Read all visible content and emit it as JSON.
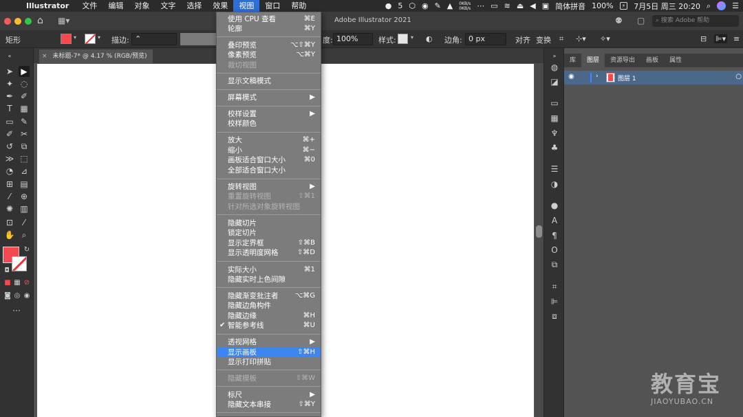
{
  "menubar": {
    "app_name": "Illustrator",
    "items": [
      "文件",
      "编辑",
      "对象",
      "文字",
      "选择",
      "效果",
      "视图",
      "窗口",
      "帮助"
    ],
    "active_index": 6,
    "status": {
      "wechat_count": "5",
      "net_up": "0KB/s",
      "net_down": "0KB/s",
      "input_method": "简体拼音",
      "battery": "100%",
      "battery_icon_text": "⚡",
      "datetime": "7月5日 周三 20:20"
    }
  },
  "titlebar": {
    "title": "Adobe Illustrator 2021",
    "search_placeholder": "搜索 Adobe 帮助"
  },
  "controlbar": {
    "shape_label": "矩形",
    "stroke_label": "描边:",
    "opacity_partial": "度:",
    "opacity_value": "100%",
    "style_label": "样式:",
    "corner_label": "边角:",
    "corner_value": "0 px",
    "align_label": "对齐",
    "transform_label": "变换"
  },
  "document_tab": {
    "title": "未标题-7* @ 4.17 % (RGB/预览)"
  },
  "layers_panel": {
    "tabs": [
      "库",
      "图层",
      "资源导出",
      "画板",
      "属性"
    ],
    "active_tab": 1,
    "layer_name": "图层 1"
  },
  "view_menu": {
    "items": [
      {
        "label": "使用 CPU 查看",
        "shortcut": "⌘E"
      },
      {
        "label": "轮廓",
        "shortcut": "⌘Y"
      },
      {
        "label": "叠印预览",
        "shortcut": "⌥⇧⌘Y"
      },
      {
        "label": "像素预览",
        "shortcut": "⌥⌘Y"
      },
      {
        "label": "裁切视图",
        "shortcut": ""
      },
      {
        "label": "显示文稿模式",
        "shortcut": ""
      },
      {
        "label": "屏幕模式",
        "shortcut": "▶"
      },
      {
        "label": "校样设置",
        "shortcut": "▶"
      },
      {
        "label": "校样颜色",
        "shortcut": ""
      },
      {
        "label": "放大",
        "shortcut": "⌘+"
      },
      {
        "label": "缩小",
        "shortcut": "⌘−"
      },
      {
        "label": "画板适合窗口大小",
        "shortcut": "⌘0"
      },
      {
        "label": "全部适合窗口大小",
        "shortcut": ""
      },
      {
        "label": "旋转视图",
        "shortcut": "▶"
      },
      {
        "label": "重置旋转视图",
        "shortcut": "⇧⌘1"
      },
      {
        "label": "针对所选对象旋转视图",
        "shortcut": ""
      },
      {
        "label": "隐藏切片",
        "shortcut": ""
      },
      {
        "label": "锁定切片",
        "shortcut": ""
      },
      {
        "label": "显示定界框",
        "shortcut": "⇧⌘B"
      },
      {
        "label": "显示透明度网格",
        "shortcut": "⇧⌘D"
      },
      {
        "label": "实际大小",
        "shortcut": "⌘1"
      },
      {
        "label": "隐藏实时上色间隙",
        "shortcut": ""
      },
      {
        "label": "隐藏渐变批注者",
        "shortcut": "⌥⌘G"
      },
      {
        "label": "隐藏边角构件",
        "shortcut": ""
      },
      {
        "label": "隐藏边缘",
        "shortcut": "⌘H"
      },
      {
        "label": "智能参考线",
        "shortcut": "⌘U",
        "checkmark": "✔"
      },
      {
        "label": "透视网格",
        "shortcut": "▶"
      },
      {
        "label": "显示画板",
        "shortcut": "⇧⌘H"
      },
      {
        "label": "显示打印拼贴",
        "shortcut": ""
      },
      {
        "label": "隐藏模板",
        "shortcut": "⇧⌘W"
      },
      {
        "label": "标尺",
        "shortcut": "▶"
      },
      {
        "label": "隐藏文本串接",
        "shortcut": "⇧⌘Y"
      }
    ]
  },
  "watermark": {
    "title": "教育宝",
    "subtitle": "JIAOYUBAO.CN"
  },
  "colors": {
    "fill": "#f5484f",
    "menu_highlight": "#3b86f0",
    "layer_row": "#4b6789"
  }
}
